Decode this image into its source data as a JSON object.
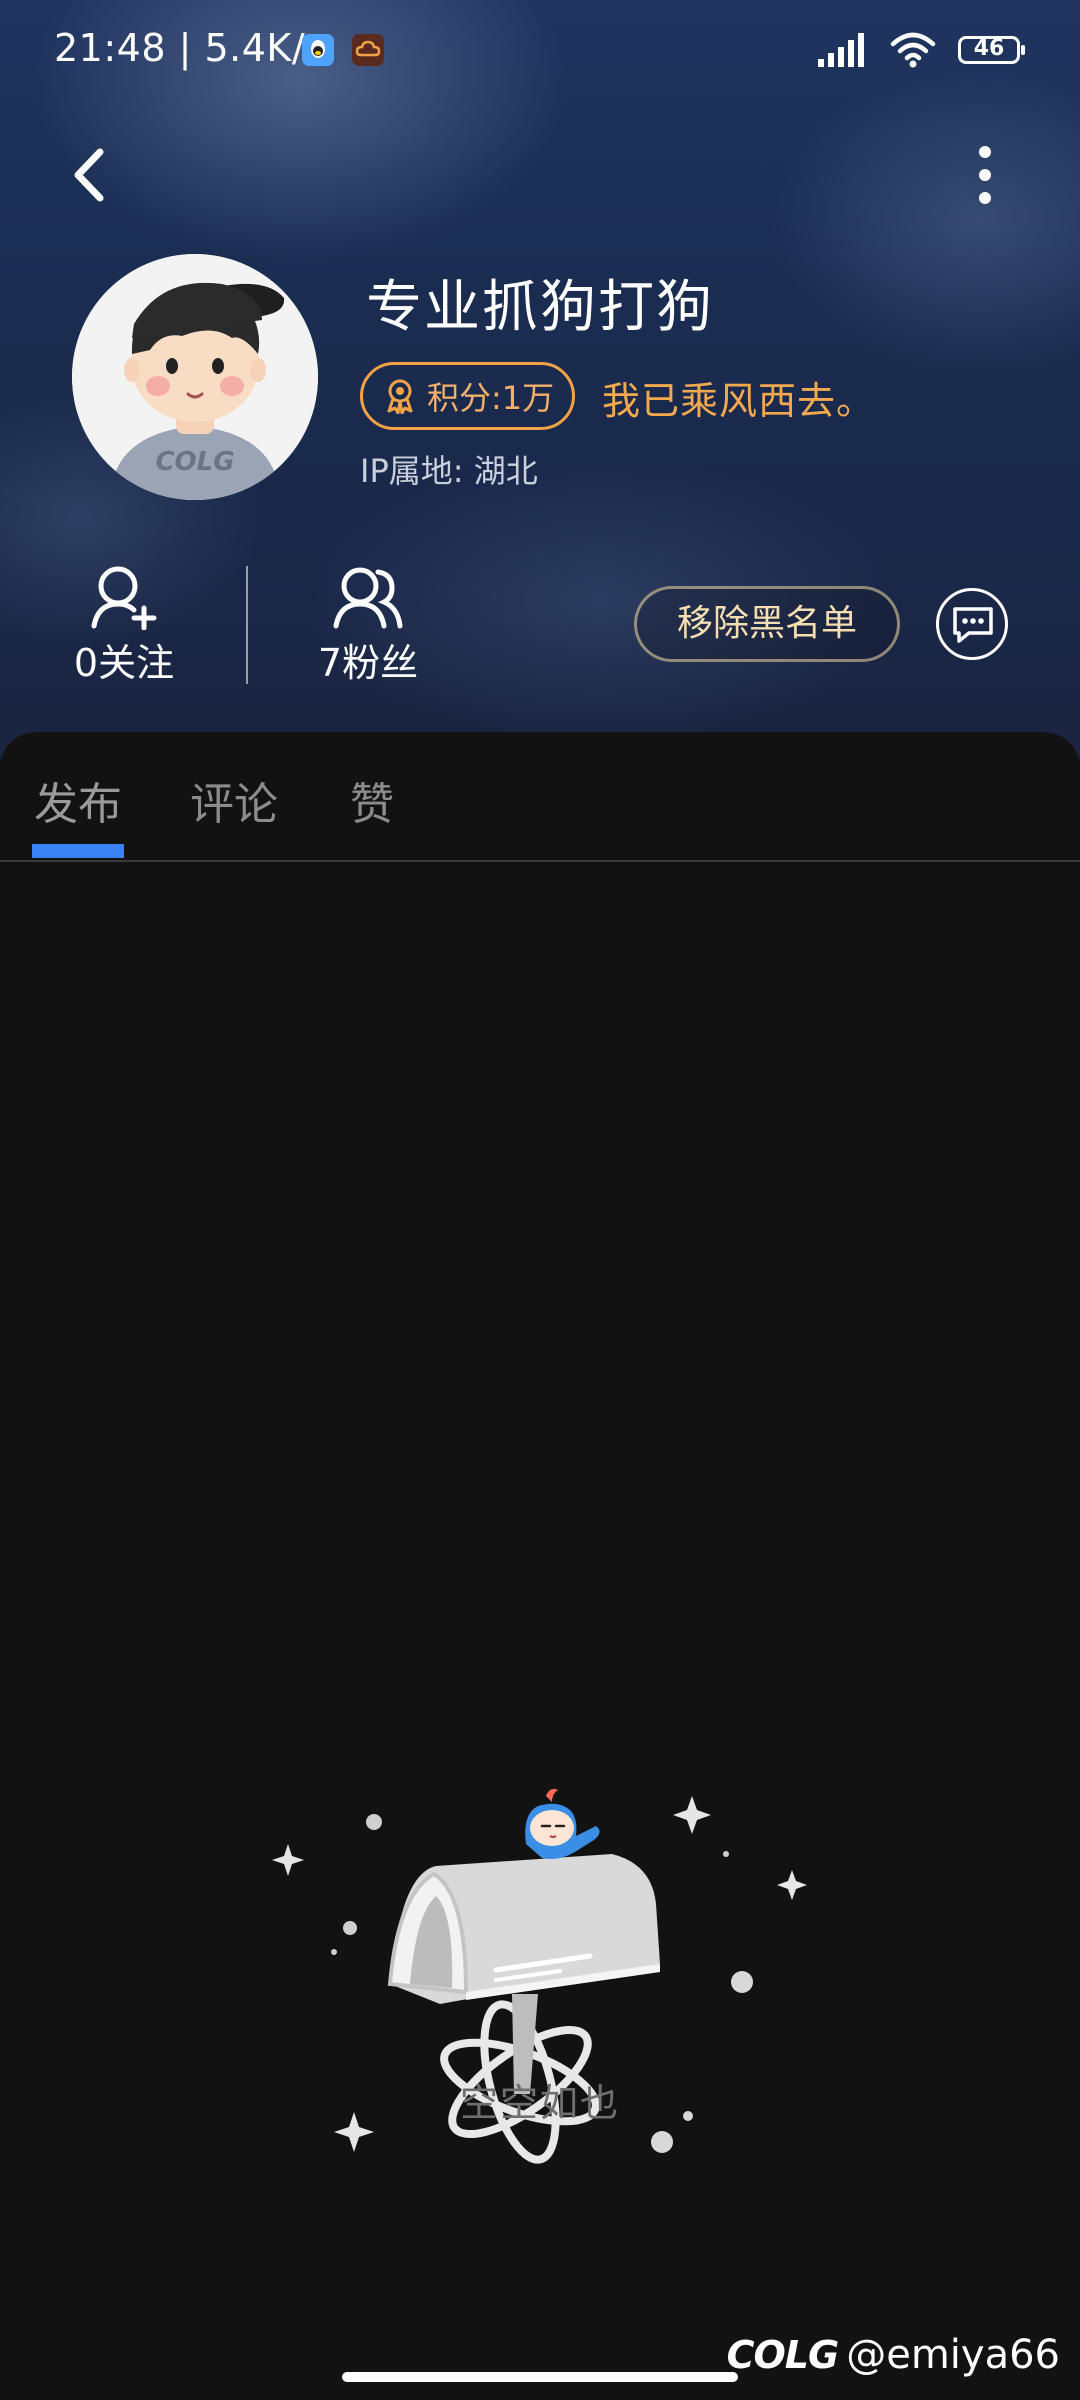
{
  "status_bar": {
    "time": "21:48",
    "network_speed": "5.4K/s",
    "battery": "46"
  },
  "profile": {
    "username": "专业抓狗打狗",
    "points": "积分:1万",
    "signature": "我已乘风西去。",
    "ip_location": "IP属地: 湖北",
    "avatar_text": "COLG"
  },
  "stats": {
    "following": "0关注",
    "fans": "7粉丝"
  },
  "actions": {
    "unblock": "移除黑名单"
  },
  "tabs": [
    {
      "label": "发布",
      "active": true
    },
    {
      "label": "评论",
      "active": false
    },
    {
      "label": "赞",
      "active": false
    }
  ],
  "empty_state": {
    "text": "空空如也"
  },
  "watermark": {
    "logo": "COLG",
    "handle": "@emiya66"
  },
  "colors": {
    "accent": "#3b82f6",
    "points": "#f2a247",
    "signature": "#f5a94f"
  }
}
